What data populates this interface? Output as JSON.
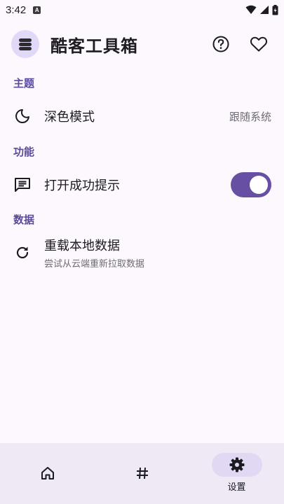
{
  "status_bar": {
    "time": "3:42",
    "notification_badge": "A"
  },
  "app_bar": {
    "title": "酷客工具箱",
    "logo_icon": "stack-layers-icon",
    "help_icon": "help-circle-icon",
    "favorite_icon": "heart-outline-icon"
  },
  "sections": {
    "theme": {
      "header": "主题",
      "items": [
        {
          "label": "深色模式",
          "value": "跟随系统",
          "icon": "moon-icon"
        }
      ]
    },
    "features": {
      "header": "功能",
      "items": [
        {
          "label": "打开成功提示",
          "icon": "message-list-icon",
          "toggle_on": true
        }
      ]
    },
    "data": {
      "header": "数据",
      "items": [
        {
          "label": "重载本地数据",
          "subtitle": "尝试从云端重新拉取数据",
          "icon": "refresh-icon"
        }
      ]
    }
  },
  "bottom_nav": {
    "items": [
      {
        "icon": "home-icon",
        "label": ""
      },
      {
        "icon": "hashtag-icon",
        "label": ""
      },
      {
        "icon": "settings-gear-icon",
        "label": "设置",
        "active": true
      }
    ]
  },
  "colors": {
    "accent": "#6750a4",
    "section_header": "#5a4a9a",
    "background": "#fdf8fd",
    "nav_background": "#efe9f5",
    "nav_active_pill": "#e1d9f3"
  }
}
